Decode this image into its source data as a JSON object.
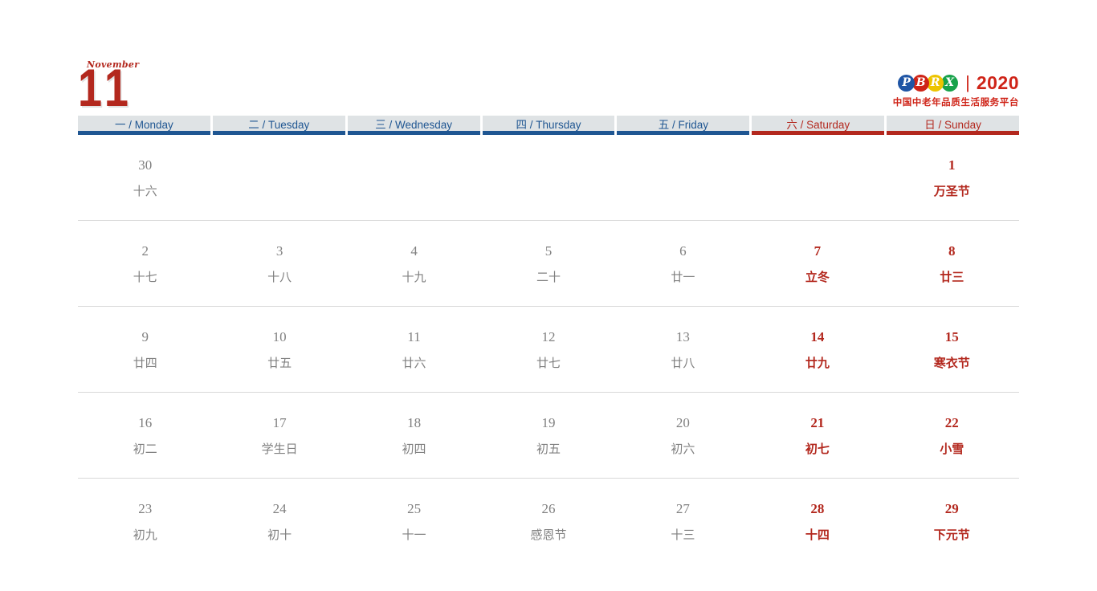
{
  "masthead": {
    "month_name": "November",
    "month_number": "11"
  },
  "brand": {
    "logo_letters": [
      "P",
      "B",
      "R",
      "X"
    ],
    "logo_colors": [
      "#1f55a5",
      "#cf2418",
      "#edc400",
      "#17a24a"
    ],
    "separator": "|",
    "year": "2020",
    "subtitle": "中国中老年品质生活服务平台",
    "accent_color": "#cf2418"
  },
  "theme": {
    "weekday_header_bg": "#dfe3e5",
    "weekday_blue": "#1f5692",
    "weekend_red": "#b3281e",
    "body_gray": "#808080",
    "row_divider": "#d9d9d9"
  },
  "weekdays": [
    {
      "label": "一 / Monday",
      "weekend": false
    },
    {
      "label": "二 / Tuesday",
      "weekend": false
    },
    {
      "label": "三 / Wednesday",
      "weekend": false
    },
    {
      "label": "四 / Thursday",
      "weekend": false
    },
    {
      "label": "五 / Friday",
      "weekend": false
    },
    {
      "label": "六 / Saturday",
      "weekend": true
    },
    {
      "label": "日 / Sunday",
      "weekend": true
    }
  ],
  "weeks": [
    [
      {
        "num": "30",
        "lunar": "十六",
        "holiday": false,
        "empty": false
      },
      {
        "num": "",
        "lunar": "",
        "holiday": false,
        "empty": true
      },
      {
        "num": "",
        "lunar": "",
        "holiday": false,
        "empty": true
      },
      {
        "num": "",
        "lunar": "",
        "holiday": false,
        "empty": true
      },
      {
        "num": "",
        "lunar": "",
        "holiday": false,
        "empty": true
      },
      {
        "num": "",
        "lunar": "",
        "holiday": false,
        "empty": true
      },
      {
        "num": "1",
        "lunar": "万圣节",
        "holiday": true,
        "empty": false
      }
    ],
    [
      {
        "num": "2",
        "lunar": "十七",
        "holiday": false,
        "empty": false
      },
      {
        "num": "3",
        "lunar": "十八",
        "holiday": false,
        "empty": false
      },
      {
        "num": "4",
        "lunar": "十九",
        "holiday": false,
        "empty": false
      },
      {
        "num": "5",
        "lunar": "二十",
        "holiday": false,
        "empty": false
      },
      {
        "num": "6",
        "lunar": "廿一",
        "holiday": false,
        "empty": false
      },
      {
        "num": "7",
        "lunar": "立冬",
        "holiday": true,
        "empty": false
      },
      {
        "num": "8",
        "lunar": "廿三",
        "holiday": true,
        "empty": false
      }
    ],
    [
      {
        "num": "9",
        "lunar": "廿四",
        "holiday": false,
        "empty": false
      },
      {
        "num": "10",
        "lunar": "廿五",
        "holiday": false,
        "empty": false
      },
      {
        "num": "11",
        "lunar": "廿六",
        "holiday": false,
        "empty": false
      },
      {
        "num": "12",
        "lunar": "廿七",
        "holiday": false,
        "empty": false
      },
      {
        "num": "13",
        "lunar": "廿八",
        "holiday": false,
        "empty": false
      },
      {
        "num": "14",
        "lunar": "廿九",
        "holiday": true,
        "empty": false
      },
      {
        "num": "15",
        "lunar": "寒衣节",
        "holiday": true,
        "empty": false
      }
    ],
    [
      {
        "num": "16",
        "lunar": "初二",
        "holiday": false,
        "empty": false
      },
      {
        "num": "17",
        "lunar": "学生日",
        "holiday": false,
        "empty": false
      },
      {
        "num": "18",
        "lunar": "初四",
        "holiday": false,
        "empty": false
      },
      {
        "num": "19",
        "lunar": "初五",
        "holiday": false,
        "empty": false
      },
      {
        "num": "20",
        "lunar": "初六",
        "holiday": false,
        "empty": false
      },
      {
        "num": "21",
        "lunar": "初七",
        "holiday": true,
        "empty": false
      },
      {
        "num": "22",
        "lunar": "小雪",
        "holiday": true,
        "empty": false
      }
    ],
    [
      {
        "num": "23",
        "lunar": "初九",
        "holiday": false,
        "empty": false
      },
      {
        "num": "24",
        "lunar": "初十",
        "holiday": false,
        "empty": false
      },
      {
        "num": "25",
        "lunar": "十一",
        "holiday": false,
        "empty": false
      },
      {
        "num": "26",
        "lunar": "感恩节",
        "holiday": false,
        "empty": false
      },
      {
        "num": "27",
        "lunar": "十三",
        "holiday": false,
        "empty": false
      },
      {
        "num": "28",
        "lunar": "十四",
        "holiday": true,
        "empty": false
      },
      {
        "num": "29",
        "lunar": "下元节",
        "holiday": true,
        "empty": false
      }
    ]
  ]
}
